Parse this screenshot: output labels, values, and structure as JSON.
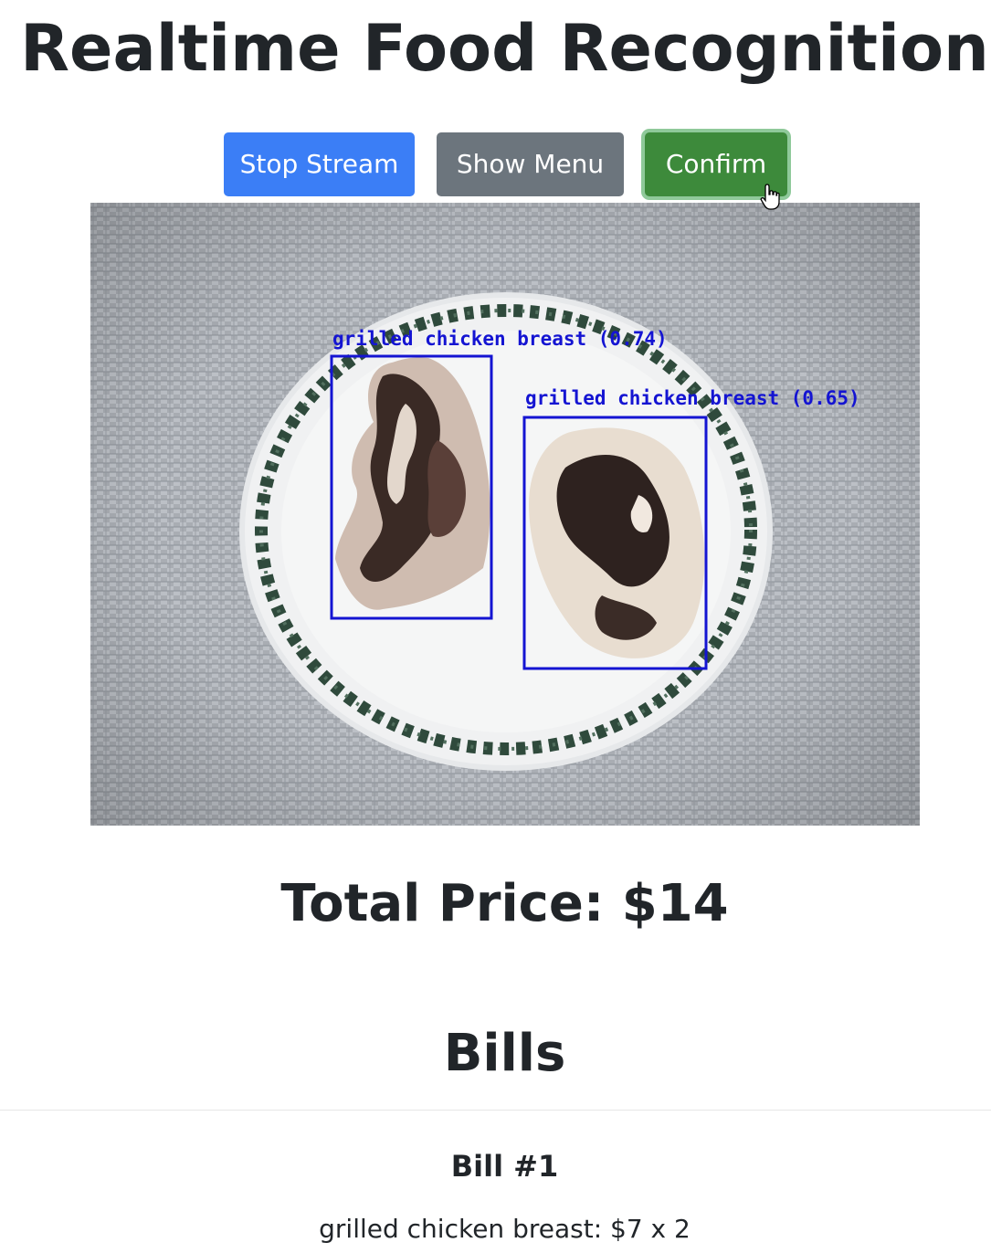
{
  "header": {
    "title": "Realtime Food Recognition"
  },
  "toolbar": {
    "stop_stream_label": "Stop Stream",
    "show_menu_label": "Show Menu",
    "confirm_label": "Confirm"
  },
  "stream": {
    "detections": [
      {
        "label": "grilled chicken breast (0.74)"
      },
      {
        "label": "grilled chicken breast (0.65)"
      }
    ]
  },
  "summary": {
    "total_price": "Total Price: $14"
  },
  "bills": {
    "heading": "Bills",
    "items": [
      {
        "title": "Bill #1",
        "line": "grilled chicken breast: $7 x 2"
      }
    ]
  },
  "colors": {
    "primary": "#3b7ef6",
    "secondary": "#6c757d",
    "success": "#3d8a3b",
    "detection_box": "#1414d2"
  },
  "icons": {
    "cursor": "hand-pointer-icon"
  }
}
